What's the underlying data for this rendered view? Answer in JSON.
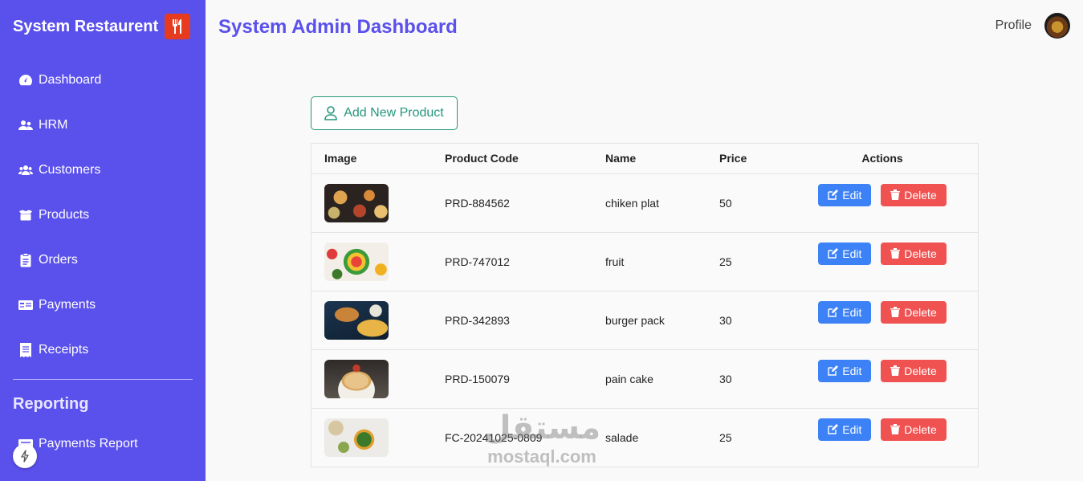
{
  "app": {
    "title": "System Restaurent",
    "logo_icon": "utensils-icon"
  },
  "sidebar": {
    "items": [
      {
        "label": "Dashboard",
        "icon": "gauge-icon"
      },
      {
        "label": "HRM",
        "icon": "users-icon"
      },
      {
        "label": "Customers",
        "icon": "user-group-icon"
      },
      {
        "label": "Products",
        "icon": "box-icon"
      },
      {
        "label": "Orders",
        "icon": "clipboard-icon"
      },
      {
        "label": "Payments",
        "icon": "money-icon"
      },
      {
        "label": "Receipts",
        "icon": "receipt-icon"
      }
    ],
    "section_title": "Reporting",
    "report_items": [
      {
        "label": "Payments Report",
        "icon": "report-icon"
      }
    ]
  },
  "header": {
    "title": "System Admin Dashboard",
    "profile_label": "Profile"
  },
  "toolbar": {
    "add_label": "Add New Product"
  },
  "table": {
    "columns": [
      "Image",
      "Product Code",
      "Name",
      "Price",
      "Actions"
    ],
    "edit_label": "Edit",
    "delete_label": "Delete",
    "rows": [
      {
        "code": "PRD-884562",
        "name": "chiken plat",
        "price": "50"
      },
      {
        "code": "PRD-747012",
        "name": "fruit",
        "price": "25"
      },
      {
        "code": "PRD-342893",
        "name": "burger pack",
        "price": "30"
      },
      {
        "code": "PRD-150079",
        "name": "pain cake",
        "price": "30"
      },
      {
        "code": "FC-20241025-0809",
        "name": "salade",
        "price": "25"
      }
    ]
  },
  "watermark": {
    "arabic": "مستقل",
    "latin": "mostaql.com"
  },
  "colors": {
    "sidebar": "#5a50ec",
    "title": "#5a50ec",
    "add_button": "#23977a",
    "edit": "#3c82f6",
    "delete": "#f05252",
    "logo": "#e63b1e"
  }
}
